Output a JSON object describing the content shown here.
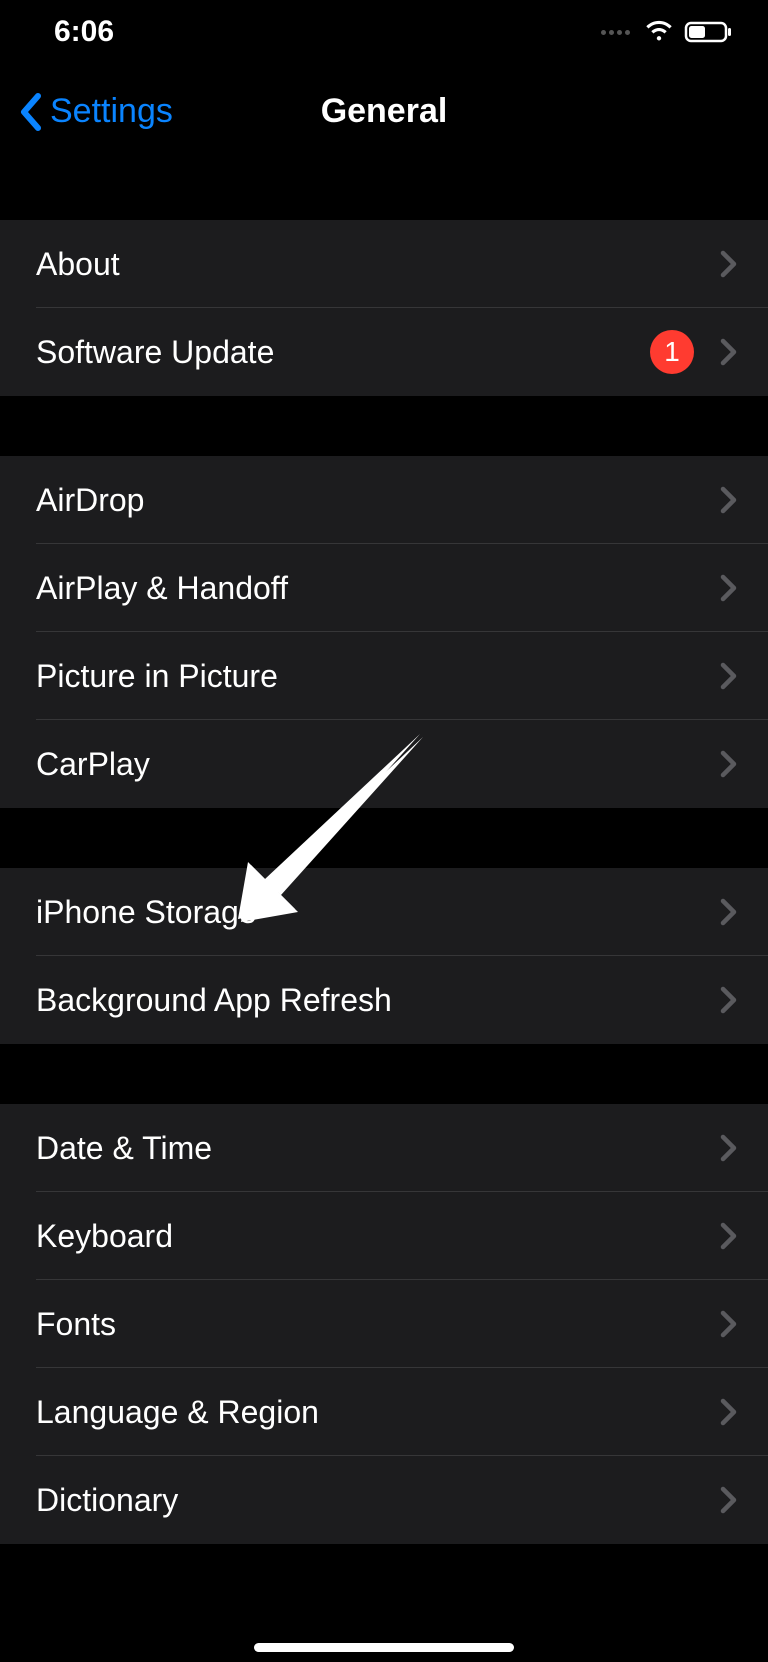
{
  "statusBar": {
    "time": "6:06"
  },
  "nav": {
    "backLabel": "Settings",
    "title": "General"
  },
  "groups": [
    {
      "items": [
        {
          "id": "about",
          "label": "About"
        },
        {
          "id": "software-update",
          "label": "Software Update",
          "badge": "1"
        }
      ]
    },
    {
      "items": [
        {
          "id": "airdrop",
          "label": "AirDrop"
        },
        {
          "id": "airplay-handoff",
          "label": "AirPlay & Handoff"
        },
        {
          "id": "picture-in-picture",
          "label": "Picture in Picture"
        },
        {
          "id": "carplay",
          "label": "CarPlay"
        }
      ]
    },
    {
      "items": [
        {
          "id": "iphone-storage",
          "label": "iPhone Storage"
        },
        {
          "id": "background-app-refresh",
          "label": "Background App Refresh"
        }
      ]
    },
    {
      "items": [
        {
          "id": "date-time",
          "label": "Date & Time"
        },
        {
          "id": "keyboard",
          "label": "Keyboard"
        },
        {
          "id": "fonts",
          "label": "Fonts"
        },
        {
          "id": "language-region",
          "label": "Language & Region"
        },
        {
          "id": "dictionary",
          "label": "Dictionary"
        }
      ]
    }
  ]
}
